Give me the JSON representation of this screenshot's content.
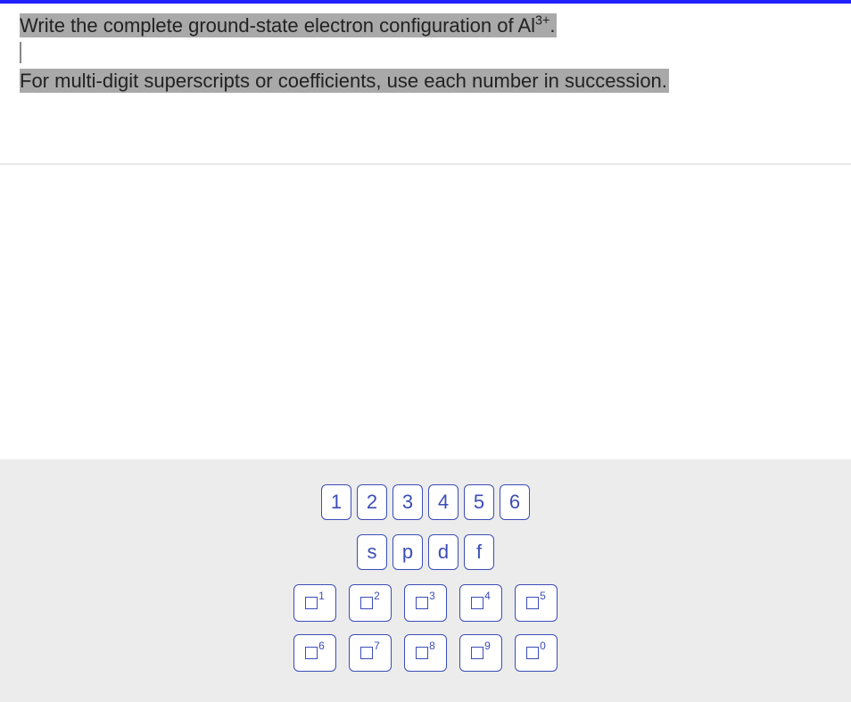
{
  "question": {
    "line1_prefix": "Write the complete ground-state electron configuration of Al",
    "line1_sup": "3+",
    "line1_suffix": ".",
    "line2": "For multi-digit superscripts or coefficients, use each number in succession."
  },
  "keypad": {
    "row1": [
      "1",
      "2",
      "3",
      "4",
      "5",
      "6"
    ],
    "row2": [
      "s",
      "p",
      "d",
      "f"
    ],
    "row3": [
      "1",
      "2",
      "3",
      "4",
      "5"
    ],
    "row4": [
      "6",
      "7",
      "8",
      "9",
      "0"
    ]
  }
}
